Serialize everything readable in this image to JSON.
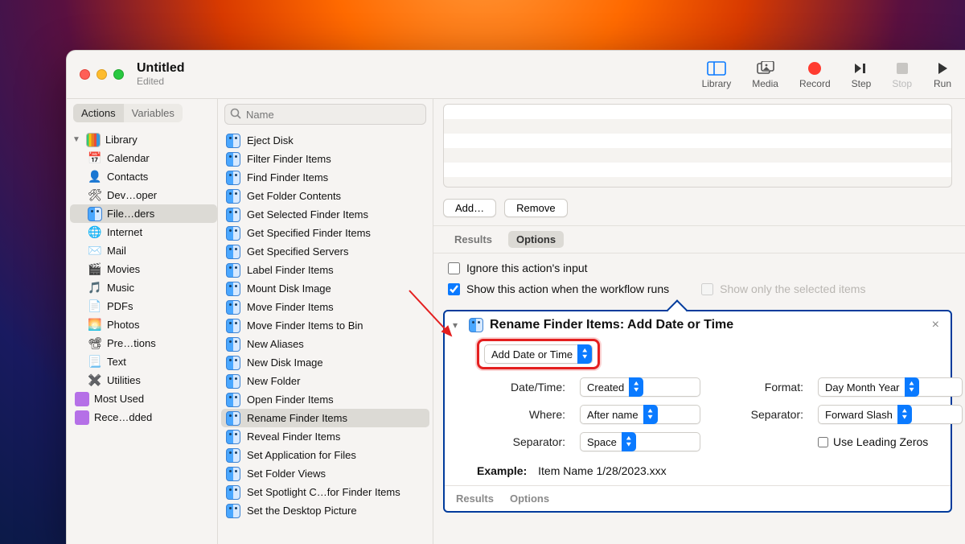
{
  "window": {
    "title": "Untitled",
    "subtitle": "Edited"
  },
  "toolbar": {
    "library": "Library",
    "media": "Media",
    "record": "Record",
    "step": "Step",
    "stop": "Stop",
    "run": "Run"
  },
  "left_tabs": {
    "actions": "Actions",
    "variables": "Variables"
  },
  "search": {
    "placeholder": "Name"
  },
  "library": {
    "root": "Library",
    "items": [
      "Calendar",
      "Contacts",
      "Dev…oper",
      "File…ders",
      "Internet",
      "Mail",
      "Movies",
      "Music",
      "PDFs",
      "Photos",
      "Pre…tions",
      "Text",
      "Utilities"
    ],
    "selected_index": 3,
    "folders": [
      "Most Used",
      "Rece…dded"
    ]
  },
  "actions": {
    "items": [
      "Eject Disk",
      "Filter Finder Items",
      "Find Finder Items",
      "Get Folder Contents",
      "Get Selected Finder Items",
      "Get Specified Finder Items",
      "Get Specified Servers",
      "Label Finder Items",
      "Mount Disk Image",
      "Move Finder Items",
      "Move Finder Items to Bin",
      "New Aliases",
      "New Disk Image",
      "New Folder",
      "Open Finder Items",
      "Rename Finder Items",
      "Reveal Finder Items",
      "Set Application for Files",
      "Set Folder Views",
      "Set Spotlight C…for Finder Items",
      "Set the Desktop Picture"
    ],
    "selected_index": 15
  },
  "workflow_buttons": {
    "add": "Add…",
    "remove": "Remove"
  },
  "sub_tabs": {
    "results": "Results",
    "options": "Options"
  },
  "options": {
    "ignore": "Ignore this action's input",
    "show_when_runs": "Show this action when the workflow runs",
    "show_only_selected": "Show only the selected items"
  },
  "card": {
    "title": "Rename Finder Items: Add Date or Time",
    "mode": "Add Date or Time",
    "labels": {
      "datetime": "Date/Time:",
      "where": "Where:",
      "separator": "Separator:",
      "format": "Format:",
      "sep2": "Separator:",
      "leading": "Use Leading Zeros",
      "example_label": "Example:"
    },
    "values": {
      "datetime": "Created",
      "where": "After name",
      "separator": "Space",
      "format": "Day Month Year",
      "sep2": "Forward Slash"
    },
    "example_value": "Item Name 1/28/2023.xxx",
    "tabs": {
      "results": "Results",
      "options": "Options"
    }
  },
  "icons": {
    "calendar": "📅",
    "contacts": "👤",
    "developer": "🛠",
    "finder": "🔵",
    "internet": "🌐",
    "mail": "✉️",
    "movies": "🎬",
    "music": "🎵",
    "pdfs": "📄",
    "photos": "🌅",
    "presentations": "📽",
    "text": "📃",
    "utilities": "✖️"
  }
}
